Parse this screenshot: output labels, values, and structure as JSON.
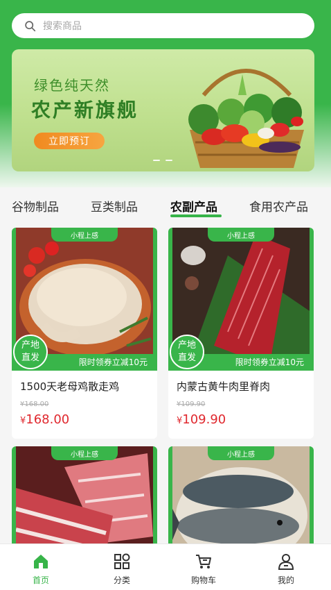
{
  "search": {
    "placeholder": "搜索商品",
    "icon": "search-icon"
  },
  "banner": {
    "subtitle": "绿色纯天然",
    "title": "农产新旗舰",
    "button": "立即预订"
  },
  "categories": [
    {
      "label": "谷物制品",
      "active": false
    },
    {
      "label": "豆类制品",
      "active": false
    },
    {
      "label": "农副产品",
      "active": true
    },
    {
      "label": "食用农产品",
      "active": false
    }
  ],
  "products": [
    {
      "ribbon": "小程上感",
      "origin_line1": "产地",
      "origin_line2": "直发",
      "coupon": "限时领券立减10元",
      "name": "1500天老母鸡散走鸡",
      "old_price": "¥168.00",
      "price_symbol": "¥",
      "price": "168.00"
    },
    {
      "ribbon": "小程上感",
      "origin_line1": "产地",
      "origin_line2": "直发",
      "coupon": "限时领券立减10元",
      "name": "内蒙古黄牛肉里脊肉",
      "old_price": "¥109.90",
      "price_symbol": "¥",
      "price": "109.90"
    },
    {
      "ribbon": "小程上感"
    },
    {
      "ribbon": "小程上感"
    }
  ],
  "tabbar": [
    {
      "label": "首页",
      "icon": "home-icon",
      "active": true
    },
    {
      "label": "分类",
      "icon": "category-icon",
      "active": false
    },
    {
      "label": "购物车",
      "icon": "cart-icon",
      "active": false
    },
    {
      "label": "我的",
      "icon": "user-icon",
      "active": false
    }
  ],
  "colors": {
    "brand_green": "#39b54a",
    "price_red": "#e0282e",
    "button_orange": "#f08a20"
  }
}
